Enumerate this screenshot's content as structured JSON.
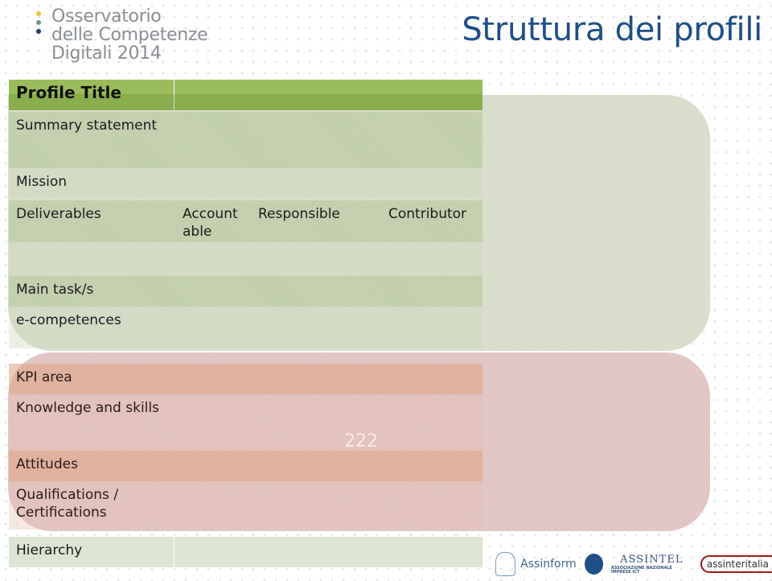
{
  "logo": {
    "lines": [
      "Osservatorio",
      "delle Competenze",
      "Digitali 2014"
    ],
    "dot_colors": [
      "#e8c43a",
      "#6f9c7c",
      "#1f3e6b"
    ],
    "initial_colors": [
      "#d8c53c",
      "#6f9c7c",
      "#1f3e6b"
    ]
  },
  "title": "Struttura dei profili",
  "table": {
    "header": {
      "label": "Profile Title",
      "value": ""
    },
    "rows": [
      {
        "label": "Summary statement",
        "value": ""
      },
      {
        "label": "Mission",
        "value": ""
      },
      {
        "label": "Deliverables",
        "columns": [
          "Account able",
          "Responsible",
          "Contributor"
        ]
      },
      {
        "label": "",
        "value": ""
      },
      {
        "label": "Main task/s",
        "value": ""
      },
      {
        "label": "e-competences",
        "value": ""
      },
      {
        "label": "KPI area",
        "value": ""
      },
      {
        "label": "Knowledge and skills",
        "value": ""
      },
      {
        "label": "Attitudes",
        "value": ""
      },
      {
        "label": "Qualifications / Certifications",
        "value": ""
      },
      {
        "label": "Hierarchy",
        "value": ""
      }
    ],
    "deliverables_columns": {
      "accountable_line1": "Account",
      "accountable_line2": "able",
      "responsible": "Responsible",
      "contributor": "Contributor"
    },
    "qualifications_line1": "Qualifications /",
    "qualifications_line2": "Certifications"
  },
  "watermark": "222",
  "footer_logos": [
    "Assinform",
    "ASSINTEL",
    "ASSOCIAZIONE NAZIONALE IMPRESE ICT",
    "assinteritalia"
  ],
  "colors": {
    "title": "#1f4e86",
    "header_green": "#9bbc5c",
    "panel_green": "#d7dcc9",
    "panel_red": "#dfc3c2"
  }
}
